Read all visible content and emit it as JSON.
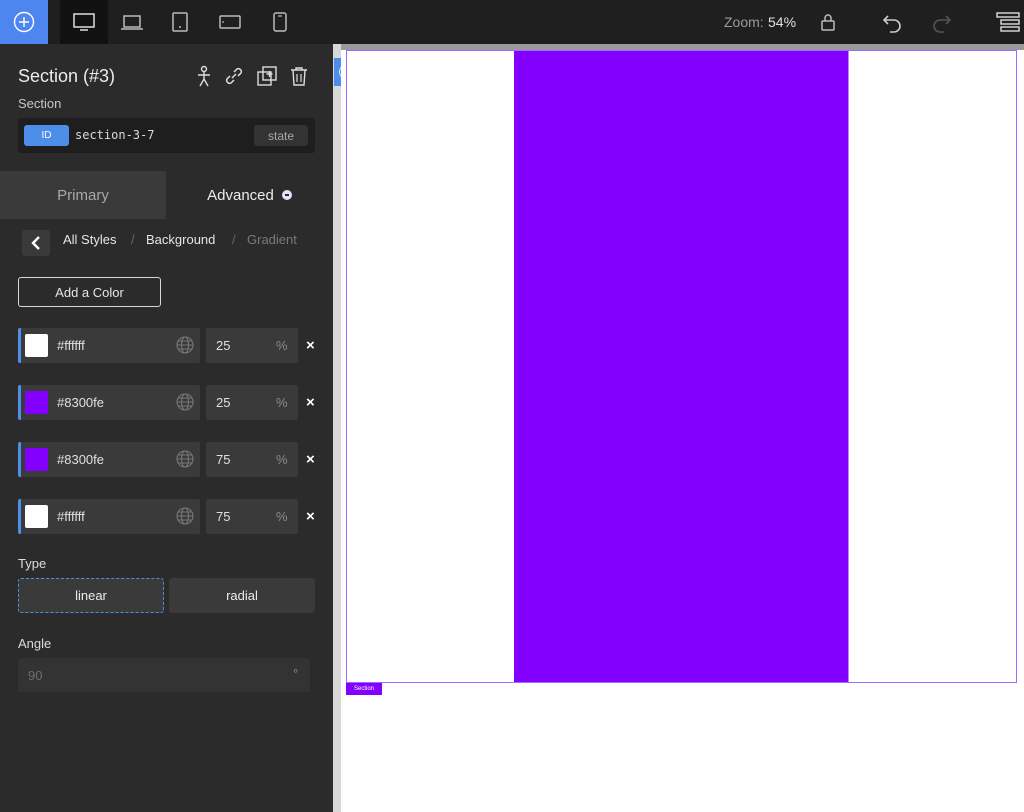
{
  "toolbar": {
    "add_icon": "plus-circle-icon",
    "devices": [
      "desktop-icon",
      "laptop-icon",
      "tablet-icon",
      "tablet-landscape-icon",
      "phone-icon"
    ],
    "zoom_label": "Zoom:",
    "zoom_value": "54%",
    "lock_icon": "lock-icon",
    "undo_icon": "undo-icon",
    "redo_icon": "redo-icon",
    "structure_icon": "structure-icon",
    "accent": "#4d86ee"
  },
  "panel": {
    "title": "Section (#3)",
    "subtitle": "Section",
    "id_badge": "ID",
    "id_value": "section-3-7",
    "state_label": "state",
    "tabs": {
      "primary": "Primary",
      "advanced": "Advanced"
    },
    "breadcrumb": {
      "all": "All Styles",
      "background": "Background",
      "gradient": "Gradient",
      "sep": "/"
    },
    "add_color_label": "Add a Color",
    "stops": [
      {
        "hex": "#ffffff",
        "pos": "25",
        "unit": "%",
        "color": "#ffffff",
        "remove": "×"
      },
      {
        "hex": "#8300fe",
        "pos": "25",
        "unit": "%",
        "color": "#8300fe",
        "remove": "×"
      },
      {
        "hex": "#8300fe",
        "pos": "75",
        "unit": "%",
        "color": "#8300fe",
        "remove": "×"
      },
      {
        "hex": "#ffffff",
        "pos": "75",
        "unit": "%",
        "color": "#ffffff",
        "remove": "×"
      }
    ],
    "type_label": "Type",
    "type_linear": "linear",
    "type_radial": "radial",
    "angle_label": "Angle",
    "angle_value": "90",
    "angle_unit": "°"
  },
  "canvas": {
    "section_tag": "Section",
    "collapse_glyph": "⟨",
    "gradient_color": "#8300fe"
  }
}
